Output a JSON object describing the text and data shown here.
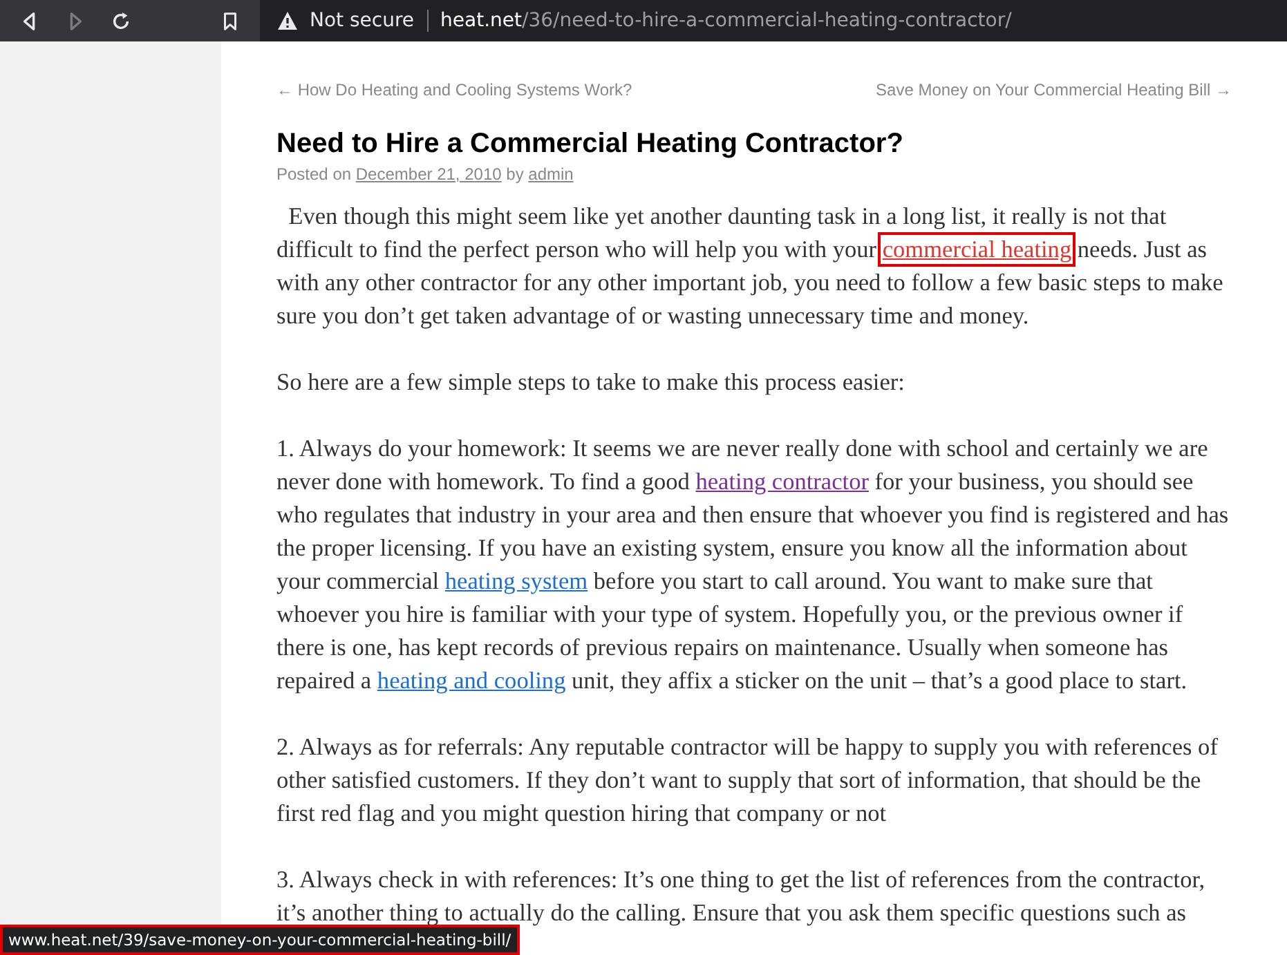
{
  "browser": {
    "forward_disabled": true,
    "security": "Not secure",
    "url_host": "heat.net",
    "url_path": "/36/need-to-hire-a-commercial-heating-contractor/"
  },
  "nav": {
    "previous": "← How Do Heating and Cooling Systems Work?",
    "next": "Save Money on Your Commercial Heating Bill →"
  },
  "post": {
    "title": "Need to Hire a Commercial Heating Contractor?",
    "posted_on": "Posted on",
    "date": "December 21, 2010",
    "by": "by",
    "author": "admin",
    "paragraphs": [
      [
        {
          "text": "  Even though this might seem like yet another daunting task in a long list, it really is not that difficult to find the perfect person who will help you with your "
        },
        {
          "link": "commercial heating",
          "color": "#e0352c",
          "highlighted": true
        },
        {
          "text": " needs. Just as with any other contractor for any other important job, you need to follow a few basic steps to make sure you don’t get taken advantage of or wasting unnecessary time and money."
        }
      ],
      [
        {
          "text": "So here are a few simple steps to take to make this process easier:"
        }
      ],
      [
        {
          "text": "1. Always do your homework: It seems we are never really done with school and certainly we are never done with homework. To find a good "
        },
        {
          "link": "heating contractor",
          "color": "#7b2f9e"
        },
        {
          "text": " for your business, you should see who regulates that industry in your area and then ensure that whoever you find is registered and has the proper licensing. If you have an existing system, ensure you know all the information about your commercial "
        },
        {
          "link": "heating system",
          "color": "#1b6fd1"
        },
        {
          "text": " before you start to call around. You want to make sure that whoever you hire is familiar with your type of system. Hopefully you, or the previous owner if there is one, has kept records of previous repairs on maintenance. Usually when someone has repaired a "
        },
        {
          "link": "heating and cooling",
          "color": "#1b6fd1"
        },
        {
          "text": " unit, they affix a sticker on the unit – that’s a good place to start."
        }
      ],
      [
        {
          "text": "2. Always as for referrals: Any reputable contractor will be happy to supply you with references of other satisfied customers. If they don’t want to supply that sort of information, that should be the first red flag and you might question hiring that company or not"
        }
      ],
      [
        {
          "text": "3. Always check in with references: It’s one thing to get the list of references from the contractor, it’s another thing to actually do the calling. Ensure that you ask them specific questions such as"
        }
      ]
    ]
  },
  "status_url": {
    "text": "www.heat.net/39/save-money-on-your-commercial-heating-bill/",
    "highlighted": true
  }
}
